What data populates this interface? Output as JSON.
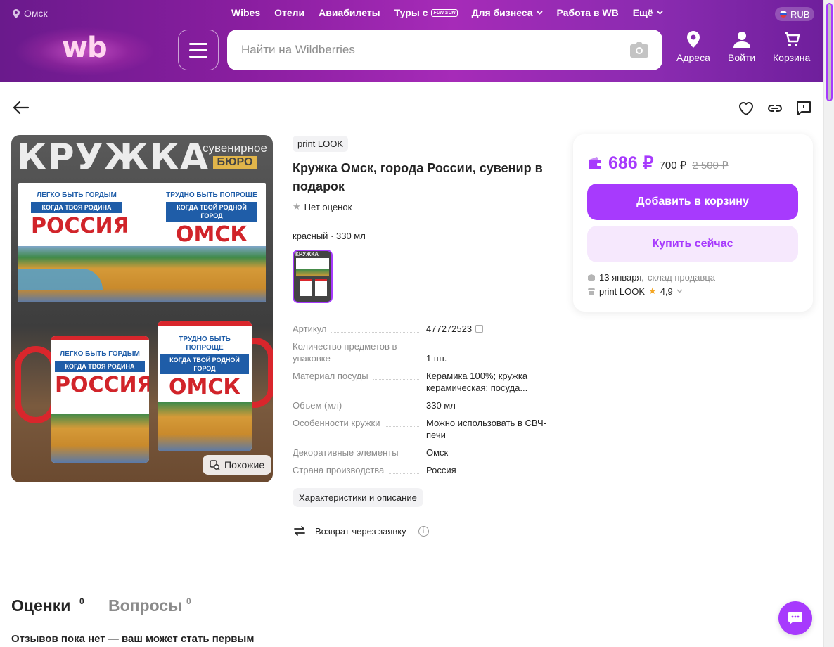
{
  "header": {
    "city": "Омск",
    "nav": [
      "Wibes",
      "Отели",
      "Авиабилеты",
      "Туры с",
      "Для бизнеса",
      "Работа в WB",
      "Ещё"
    ],
    "tours_badge": "FUN SUN",
    "currency": "RUB",
    "logo": "wb",
    "search_placeholder": "Найти на Wildberries",
    "addresses": "Адреса",
    "login": "Войти",
    "cart": "Корзина"
  },
  "gallery": {
    "title": "КРУЖКА",
    "bureau_line1": "сувенирное",
    "bureau_line2": "БЮРО",
    "left_slogan_1": "ЛЕГКО БЫТЬ ГОРДЫМ",
    "left_slogan_2": "КОГДА ТВОЯ РОДИНА",
    "left_big": "РОССИЯ",
    "right_slogan_1": "ТРУДНО БЫТЬ ПОПРОЩЕ",
    "right_slogan_2": "КОГДА ТВОЙ РОДНОЙ ГОРОД",
    "right_big": "ОМСК",
    "similar": "Похожие"
  },
  "product": {
    "brand": "print LOOK",
    "title": "Кружка Омск, города России, сувенир в подарок",
    "rating": "Нет оценок",
    "variant": "красный · 330 мл",
    "thumb_label": "КРУЖКА",
    "specs": [
      {
        "k": "Артикул",
        "v": "477272523"
      },
      {
        "k": "Количество предметов в упаковке",
        "v": "1 шт."
      },
      {
        "k": "Материал посуды",
        "v": "Керамика 100%; кружка керамическая; посуда..."
      },
      {
        "k": "Объем (мл)",
        "v": "330 мл"
      },
      {
        "k": "Особенности кружки",
        "v": "Можно использовать в СВЧ-печи"
      },
      {
        "k": "Декоративные элементы",
        "v": "Омск"
      },
      {
        "k": "Страна производства",
        "v": "Россия"
      }
    ],
    "chars_button": "Характеристики и описание",
    "return_text": "Возврат через заявку"
  },
  "buy": {
    "price": "686 ₽",
    "price_wallet_alt": "700 ₽",
    "old_price": "2 500 ₽",
    "add_to_cart": "Добавить в корзину",
    "buy_now": "Купить сейчас",
    "delivery_date": "13 января,",
    "delivery_source": "склад продавца",
    "seller": "print LOOK",
    "seller_rating": "4,9"
  },
  "reviews": {
    "tab_reviews": "Оценки",
    "tab_reviews_count": "0",
    "tab_questions": "Вопросы",
    "tab_questions_count": "0",
    "empty": "Отзывов пока нет — ваш может стать первым"
  },
  "colors": {
    "accent": "#a73afd",
    "header_from": "#6a1a8c",
    "header_to": "#a62bb8"
  }
}
